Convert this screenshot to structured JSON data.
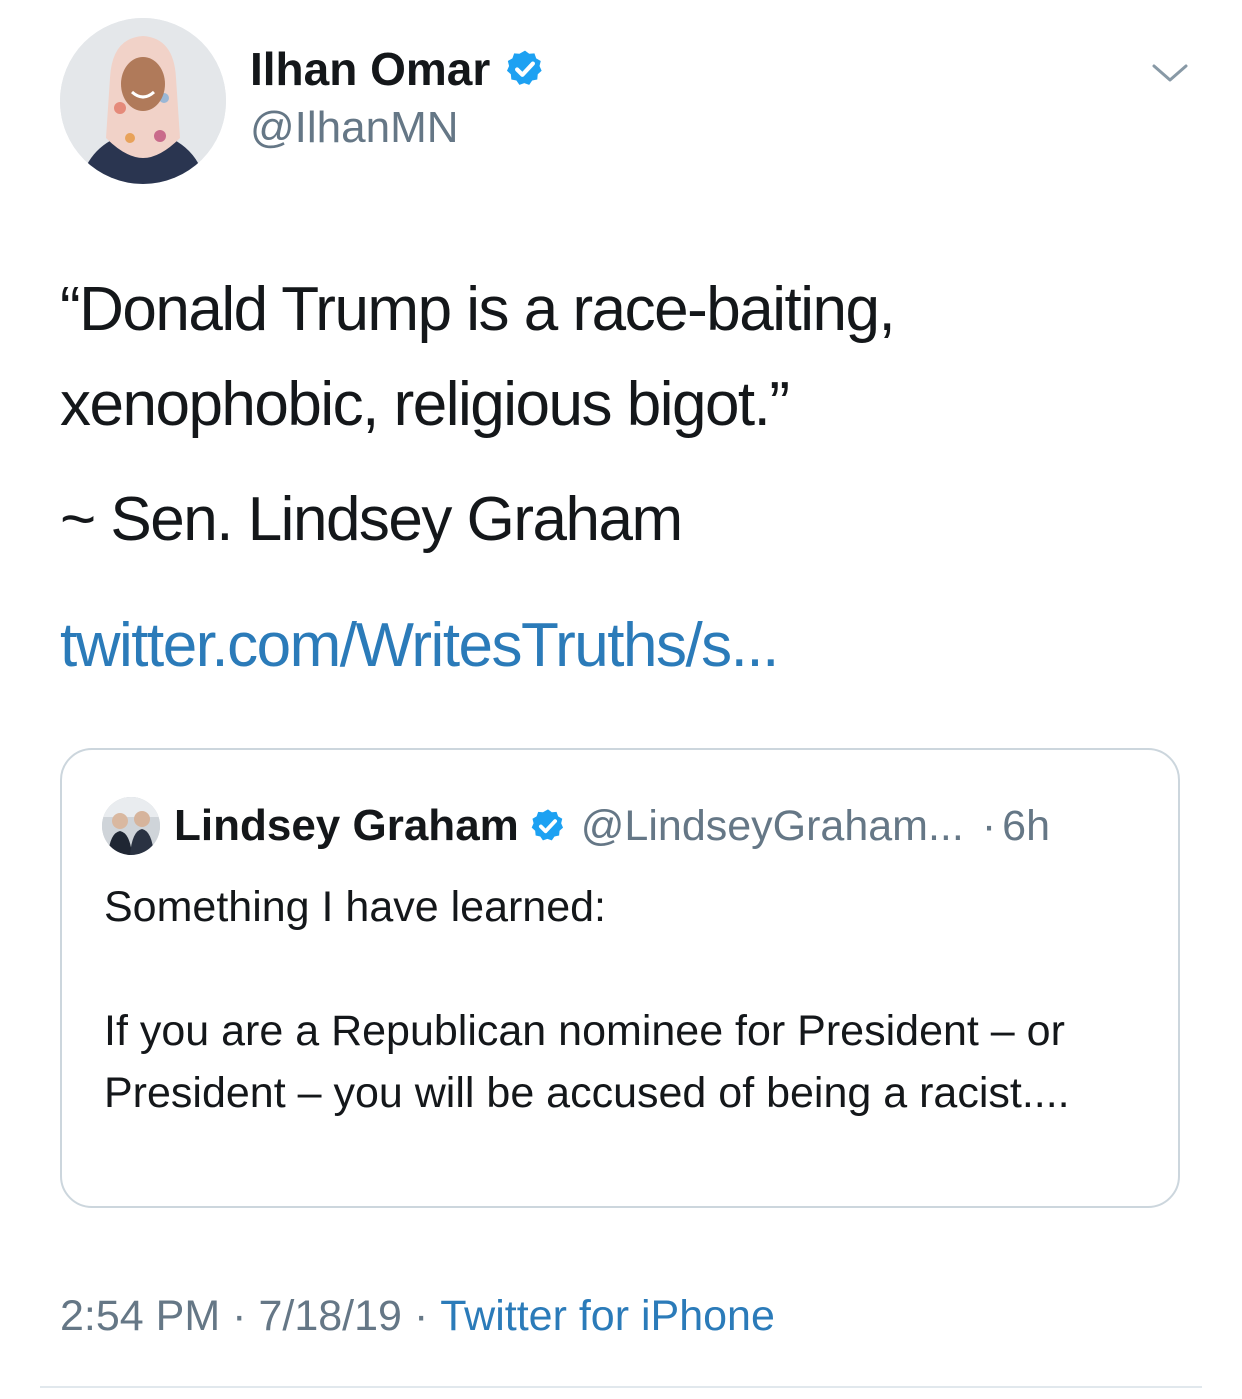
{
  "author": {
    "name": "Ilhan Omar",
    "handle": "@IlhanMN",
    "verified": true,
    "avatar_icon": "profile-photo"
  },
  "tweet": {
    "text": "“Donald Trump is a race-baiting, xenophobic, religious bigot.”",
    "attribution": "~ Sen. Lindsey Graham",
    "link": "twitter.com/WritesTruths/s..."
  },
  "quoted_tweet": {
    "name": "Lindsey Graham",
    "handle": "@LindseyGraham...",
    "separator": "·",
    "time": "6h",
    "verified": true,
    "text_line1": "Something I have learned:",
    "text_line2": "If you are a Republican nominee for President – or President – you will be accused of being a racist...."
  },
  "meta": {
    "time": "2:54 PM",
    "date": "7/18/19",
    "separator": "·",
    "source": "Twitter for iPhone"
  },
  "colors": {
    "link": "#2b7bb9",
    "verified": "#1da1f2",
    "secondary_text": "#657786",
    "border": "#ccd6dd"
  }
}
